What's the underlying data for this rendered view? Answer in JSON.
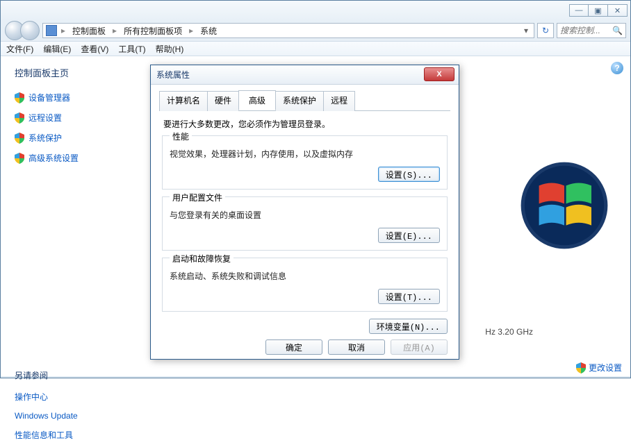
{
  "titlebar": {
    "min": "—",
    "max": "▣",
    "close": "✕"
  },
  "breadcrumb": {
    "items": [
      "控制面板",
      "所有控制面板项",
      "系统"
    ],
    "sep": "▸",
    "drop": "▾",
    "refresh": "↻"
  },
  "search": {
    "placeholder": "搜索控制...",
    "icon": "🔍"
  },
  "menubar": [
    "文件(F)",
    "编辑(E)",
    "查看(V)",
    "工具(T)",
    "帮助(H)"
  ],
  "sidebar": {
    "title": "控制面板主页",
    "links": [
      "设备管理器",
      "远程设置",
      "系统保护",
      "高级系统设置"
    ],
    "see_also_title": "另请参阅",
    "see_also": [
      "操作中心",
      "Windows Update",
      "性能信息和工具"
    ]
  },
  "help": "?",
  "main": {
    "speed": "Hz   3.20 GHz",
    "footer_link": "更改设置"
  },
  "dialog": {
    "title": "系统属性",
    "close": "X",
    "tabs": [
      "计算机名",
      "硬件",
      "高级",
      "系统保护",
      "远程"
    ],
    "desc": "要进行大多数更改，您必须作为管理员登录。",
    "groups": [
      {
        "title": "性能",
        "desc": "视觉效果，处理器计划，内存使用，以及虚拟内存",
        "btn": "设置(S)..."
      },
      {
        "title": "用户配置文件",
        "desc": "与您登录有关的桌面设置",
        "btn": "设置(E)..."
      },
      {
        "title": "启动和故障恢复",
        "desc": "系统启动、系统失败和调试信息",
        "btn": "设置(T)..."
      }
    ],
    "env_btn": "环境变量(N)...",
    "ok": "确定",
    "cancel": "取消",
    "apply": "应用(A)"
  }
}
